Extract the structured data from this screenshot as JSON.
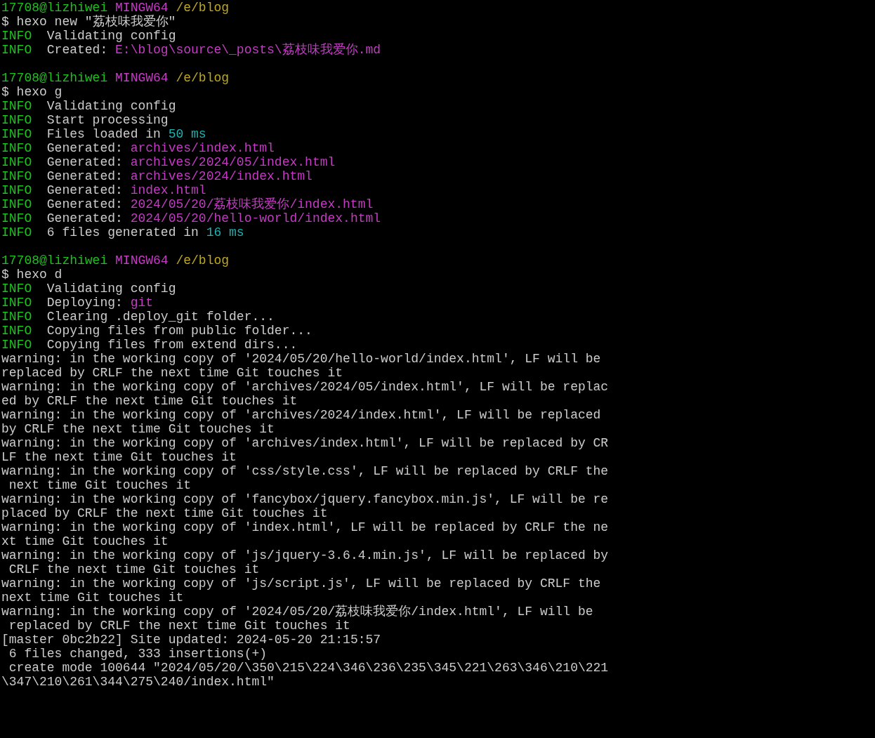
{
  "blocks": [
    {
      "prompt": {
        "user": "17708@lizhiwei",
        "host": "MINGW64",
        "path": "/e/blog"
      },
      "command": "$ hexo new \"荔枝味我爱你\"",
      "output": [
        {
          "segments": [
            {
              "kind": "info",
              "text": "INFO"
            },
            {
              "kind": "text",
              "text": "Validating config"
            }
          ]
        },
        {
          "segments": [
            {
              "kind": "info",
              "text": "INFO"
            },
            {
              "kind": "text",
              "text": "Created: "
            },
            {
              "kind": "path",
              "text": "E:\\blog\\source\\_posts\\荔枝味我爱你.md"
            }
          ]
        }
      ]
    },
    {
      "prompt": {
        "user": "17708@lizhiwei",
        "host": "MINGW64",
        "path": "/e/blog"
      },
      "command": "$ hexo g",
      "output": [
        {
          "segments": [
            {
              "kind": "info",
              "text": "INFO"
            },
            {
              "kind": "text",
              "text": "Validating config"
            }
          ]
        },
        {
          "segments": [
            {
              "kind": "info",
              "text": "INFO"
            },
            {
              "kind": "text",
              "text": "Start processing"
            }
          ]
        },
        {
          "segments": [
            {
              "kind": "info",
              "text": "INFO"
            },
            {
              "kind": "text",
              "text": "Files loaded in "
            },
            {
              "kind": "number",
              "text": "50 ms"
            }
          ]
        },
        {
          "segments": [
            {
              "kind": "info",
              "text": "INFO"
            },
            {
              "kind": "text",
              "text": "Generated: "
            },
            {
              "kind": "path",
              "text": "archives/index.html"
            }
          ]
        },
        {
          "segments": [
            {
              "kind": "info",
              "text": "INFO"
            },
            {
              "kind": "text",
              "text": "Generated: "
            },
            {
              "kind": "path",
              "text": "archives/2024/05/index.html"
            }
          ]
        },
        {
          "segments": [
            {
              "kind": "info",
              "text": "INFO"
            },
            {
              "kind": "text",
              "text": "Generated: "
            },
            {
              "kind": "path",
              "text": "archives/2024/index.html"
            }
          ]
        },
        {
          "segments": [
            {
              "kind": "info",
              "text": "INFO"
            },
            {
              "kind": "text",
              "text": "Generated: "
            },
            {
              "kind": "path",
              "text": "index.html"
            }
          ]
        },
        {
          "segments": [
            {
              "kind": "info",
              "text": "INFO"
            },
            {
              "kind": "text",
              "text": "Generated: "
            },
            {
              "kind": "path",
              "text": "2024/05/20/荔枝味我爱你/index.html"
            }
          ]
        },
        {
          "segments": [
            {
              "kind": "info",
              "text": "INFO"
            },
            {
              "kind": "text",
              "text": "Generated: "
            },
            {
              "kind": "path",
              "text": "2024/05/20/hello-world/index.html"
            }
          ]
        },
        {
          "segments": [
            {
              "kind": "info",
              "text": "INFO"
            },
            {
              "kind": "text",
              "text": "6 files generated in "
            },
            {
              "kind": "number",
              "text": "16 ms"
            }
          ]
        }
      ]
    },
    {
      "prompt": {
        "user": "17708@lizhiwei",
        "host": "MINGW64",
        "path": "/e/blog"
      },
      "command": "$ hexo d",
      "output": [
        {
          "segments": [
            {
              "kind": "info",
              "text": "INFO"
            },
            {
              "kind": "text",
              "text": "Validating config"
            }
          ]
        },
        {
          "segments": [
            {
              "kind": "info",
              "text": "INFO"
            },
            {
              "kind": "text",
              "text": "Deploying: "
            },
            {
              "kind": "path",
              "text": "git"
            }
          ]
        },
        {
          "segments": [
            {
              "kind": "info",
              "text": "INFO"
            },
            {
              "kind": "text",
              "text": "Clearing .deploy_git folder..."
            }
          ]
        },
        {
          "segments": [
            {
              "kind": "info",
              "text": "INFO"
            },
            {
              "kind": "text",
              "text": "Copying files from public folder..."
            }
          ]
        },
        {
          "segments": [
            {
              "kind": "info",
              "text": "INFO"
            },
            {
              "kind": "text",
              "text": "Copying files from extend dirs..."
            }
          ]
        },
        {
          "segments": [
            {
              "kind": "text",
              "text": "warning: in the working copy of '2024/05/20/hello-world/index.html', LF will be"
            }
          ]
        },
        {
          "segments": [
            {
              "kind": "text",
              "text": "replaced by CRLF the next time Git touches it"
            }
          ]
        },
        {
          "segments": [
            {
              "kind": "text",
              "text": "warning: in the working copy of 'archives/2024/05/index.html', LF will be replac"
            }
          ]
        },
        {
          "segments": [
            {
              "kind": "text",
              "text": "ed by CRLF the next time Git touches it"
            }
          ]
        },
        {
          "segments": [
            {
              "kind": "text",
              "text": "warning: in the working copy of 'archives/2024/index.html', LF will be replaced"
            }
          ]
        },
        {
          "segments": [
            {
              "kind": "text",
              "text": "by CRLF the next time Git touches it"
            }
          ]
        },
        {
          "segments": [
            {
              "kind": "text",
              "text": "warning: in the working copy of 'archives/index.html', LF will be replaced by CR"
            }
          ]
        },
        {
          "segments": [
            {
              "kind": "text",
              "text": "LF the next time Git touches it"
            }
          ]
        },
        {
          "segments": [
            {
              "kind": "text",
              "text": "warning: in the working copy of 'css/style.css', LF will be replaced by CRLF the"
            }
          ]
        },
        {
          "segments": [
            {
              "kind": "text",
              "text": " next time Git touches it"
            }
          ]
        },
        {
          "segments": [
            {
              "kind": "text",
              "text": "warning: in the working copy of 'fancybox/jquery.fancybox.min.js', LF will be re"
            }
          ]
        },
        {
          "segments": [
            {
              "kind": "text",
              "text": "placed by CRLF the next time Git touches it"
            }
          ]
        },
        {
          "segments": [
            {
              "kind": "text",
              "text": "warning: in the working copy of 'index.html', LF will be replaced by CRLF the ne"
            }
          ]
        },
        {
          "segments": [
            {
              "kind": "text",
              "text": "xt time Git touches it"
            }
          ]
        },
        {
          "segments": [
            {
              "kind": "text",
              "text": "warning: in the working copy of 'js/jquery-3.6.4.min.js', LF will be replaced by"
            }
          ]
        },
        {
          "segments": [
            {
              "kind": "text",
              "text": " CRLF the next time Git touches it"
            }
          ]
        },
        {
          "segments": [
            {
              "kind": "text",
              "text": "warning: in the working copy of 'js/script.js', LF will be replaced by CRLF the"
            }
          ]
        },
        {
          "segments": [
            {
              "kind": "text",
              "text": "next time Git touches it"
            }
          ]
        },
        {
          "segments": [
            {
              "kind": "text",
              "text": "warning: in the working copy of '2024/05/20/荔枝味我爱你/index.html', LF will be"
            }
          ]
        },
        {
          "segments": [
            {
              "kind": "text",
              "text": " replaced by CRLF the next time Git touches it"
            }
          ]
        },
        {
          "segments": [
            {
              "kind": "text",
              "text": "[master 0bc2b22] Site updated: 2024-05-20 21:15:57"
            }
          ]
        },
        {
          "segments": [
            {
              "kind": "text",
              "text": " 6 files changed, 333 insertions(+)"
            }
          ]
        },
        {
          "segments": [
            {
              "kind": "text",
              "text": " create mode 100644 \"2024/05/20/\\350\\215\\224\\346\\236\\235\\345\\221\\263\\346\\210\\221"
            }
          ]
        },
        {
          "segments": [
            {
              "kind": "text",
              "text": "\\347\\210\\261\\344\\275\\240/index.html\""
            }
          ]
        }
      ]
    }
  ]
}
